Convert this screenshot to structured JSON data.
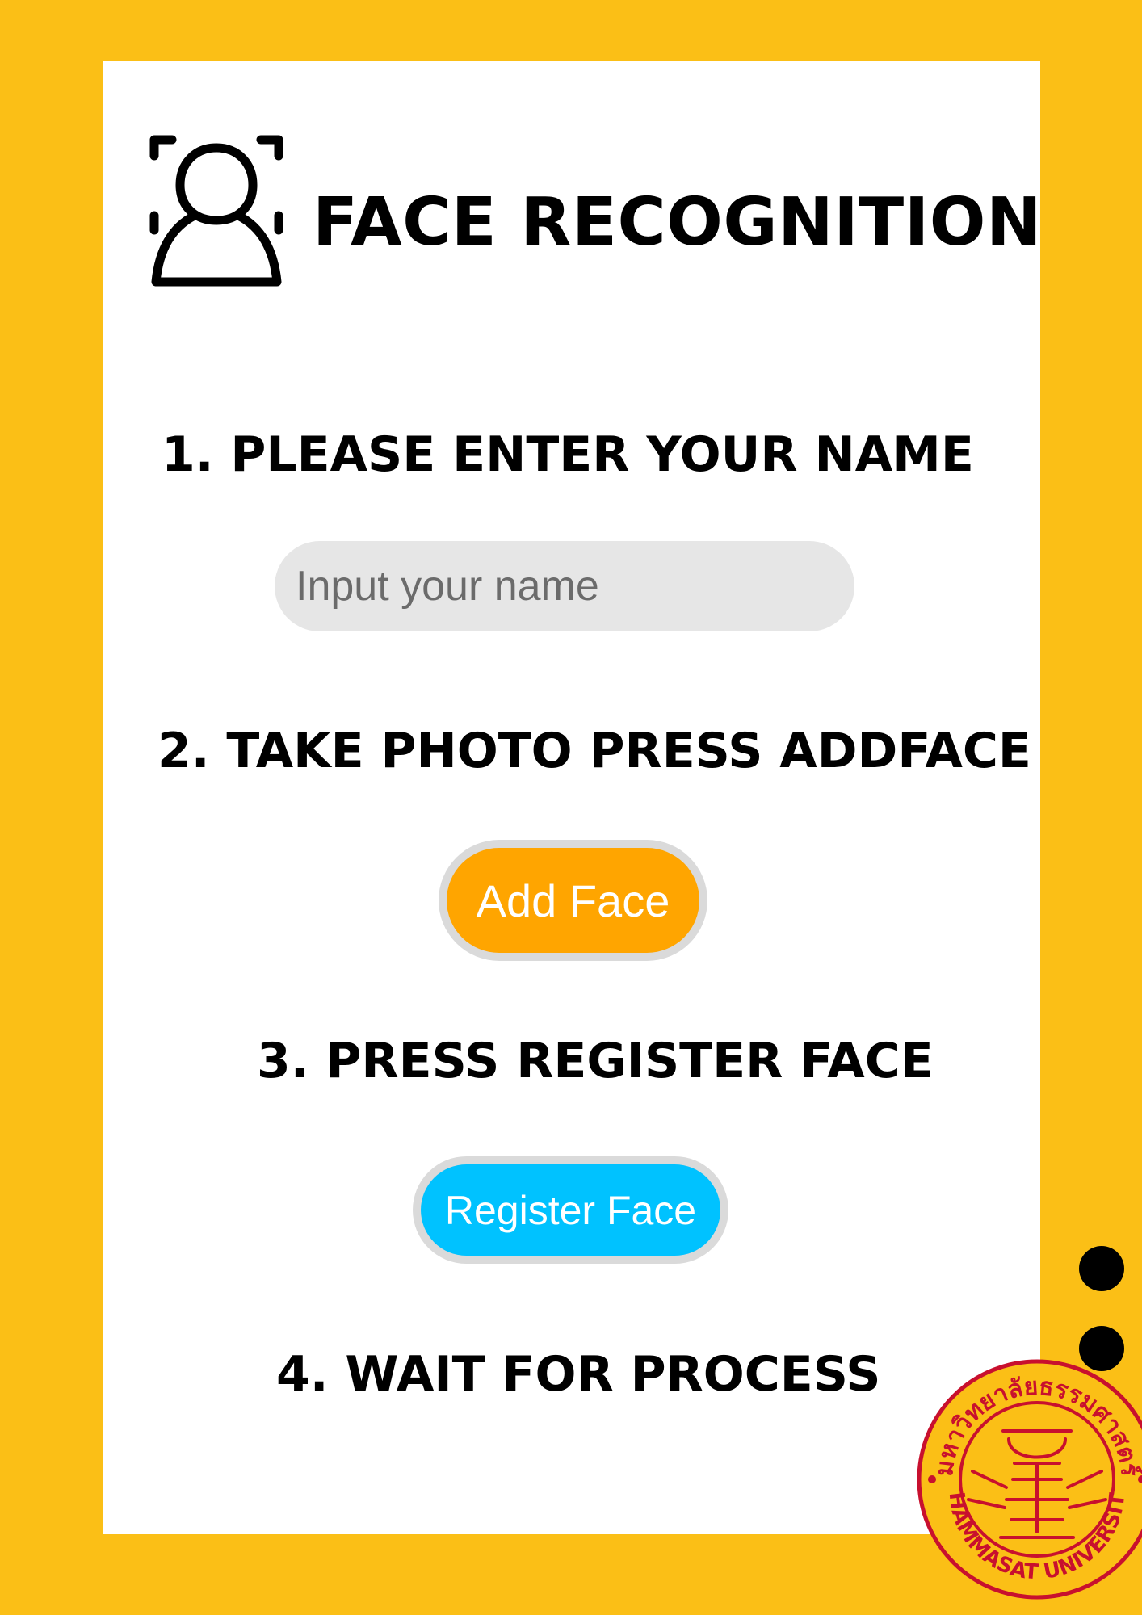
{
  "header": {
    "icon": "face-recognition-icon",
    "title": "FACE RECOGNITION"
  },
  "steps": [
    {
      "label": "1. PLEASE ENTER YOUR NAME"
    },
    {
      "label": "2. TAKE PHOTO PRESS ADDFACE"
    },
    {
      "label": "3. PRESS REGISTER FACE"
    },
    {
      "label": "4. WAIT FOR PROCESS"
    }
  ],
  "name_input": {
    "placeholder": "Input your name",
    "value": ""
  },
  "buttons": {
    "add_face_label": "Add Face",
    "register_face_label": "Register Face"
  },
  "seal": {
    "text_top": "มหาวิทยาลัยธรรมศาสตร์",
    "text_bottom": "THAMMASAT UNIVERSITY"
  },
  "colors": {
    "background": "#FBBF16",
    "card": "#FFFFFF",
    "add_face": "#FFA500",
    "register_face": "#00C2FF",
    "seal_red": "#C8102E"
  }
}
